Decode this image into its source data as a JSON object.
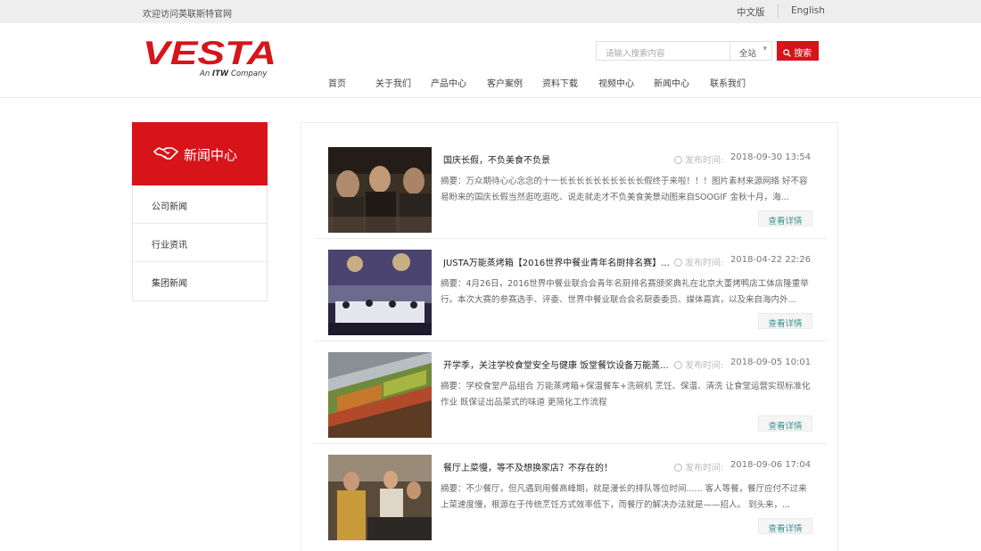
{
  "topbar": {
    "welcome": "欢迎访问英联斯特官网",
    "lang_cn": "中文版",
    "lang_en": "English"
  },
  "logo": {
    "brand": "VESTA",
    "tagline_prefix": "An",
    "tagline_mark": "ITW",
    "tagline_suffix": "Company",
    "brand_color": "#d7141a"
  },
  "search": {
    "placeholder": "请输入搜索内容",
    "scope": "全站",
    "button_label": "搜索"
  },
  "nav": {
    "items": [
      "首页",
      "关于我们",
      "产品中心",
      "客户案例",
      "资料下载",
      "视频中心",
      "新闻中心",
      "联系我们"
    ]
  },
  "sidebar": {
    "title": "新闻中心",
    "items": [
      "公司新闻",
      "行业资讯",
      "集团新闻"
    ]
  },
  "news": {
    "time_label": "发布时间:",
    "more_label": "查看详情",
    "items": [
      {
        "title": "国庆长假，不负美食不负景",
        "time": "2018-09-30 13:54",
        "summary": "摘要：万众期待心心念念的十一长长长长长长长长长长假终于来啦！！！图片素材来源网络 好不容易盼来的国庆长假当然逛吃逛吃、说走就走才不负美食美景动图来自SOOGIF 金秋十月，海..."
      },
      {
        "title": "JUSTA万能蒸烤箱【2016世界中餐业青年名厨排名赛】...",
        "time": "2018-04-22 22:26",
        "summary": "摘要：4月26日，2016世界中餐业联合会青年名厨排名赛颁奖典礼在北京大董烤鸭店工体店隆重举行。本次大赛的参赛选手、评委、世界中餐业联合会名厨委委员、媒体嘉宾，以及来自海内外..."
      },
      {
        "title": "开学季，关注学校食堂安全与健康 饭堂餐饮设备万能蒸...",
        "time": "2018-09-05 10:01",
        "summary": "摘要：学校食堂产品组合 万能蒸烤箱+保温餐车+洗碗机 烹饪、保温、清洗 让食堂运营实现标准化作业 既保证出品菜式的味道 更简化工作流程"
      },
      {
        "title": "餐厅上菜慢，等不及想换家店？不存在的！",
        "time": "2018-09-06 17:04",
        "summary": "摘要：不少餐厅，但凡遇到用餐高峰期，就是漫长的排队等位时间...... 客人等餐，餐厅应付不过来 上菜速度慢，根源在于传统烹饪方式效率低下，而餐厅的解决办法就是——招人。 到头来，..."
      }
    ]
  }
}
